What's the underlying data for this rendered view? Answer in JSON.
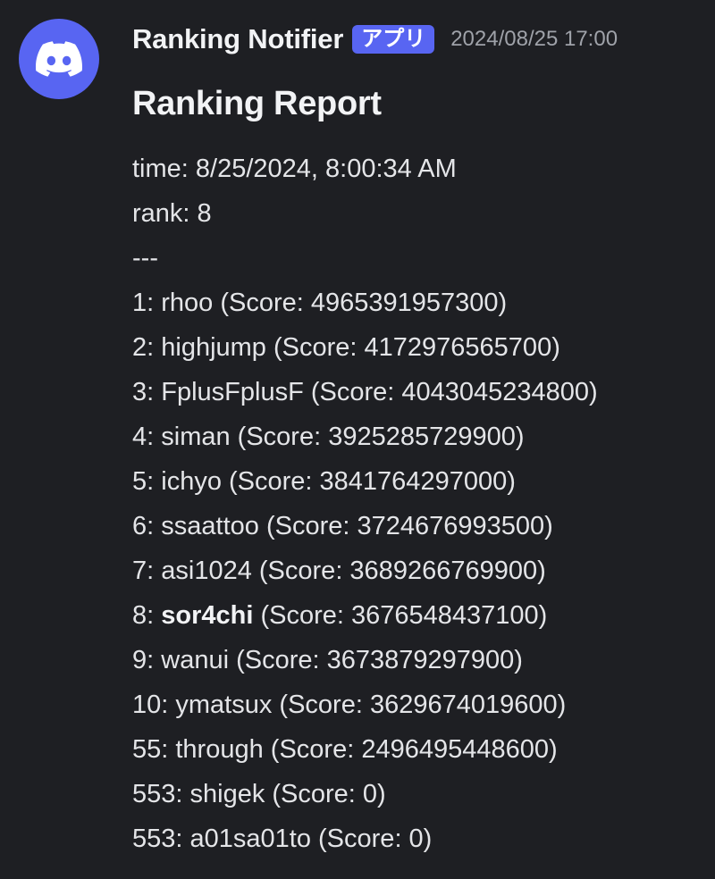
{
  "author": {
    "name": "Ranking Notifier",
    "badge": "アプリ",
    "timestamp": "2024/08/25 17:00"
  },
  "report": {
    "title": "Ranking Report",
    "time_line": "time: 8/25/2024, 8:00:34 AM",
    "rank_line": "rank: 8",
    "separator": "---",
    "entries": [
      {
        "prefix": "1: ",
        "name": "rhoo",
        "suffix": " (Score: 4965391957300)",
        "bold": false
      },
      {
        "prefix": "2: ",
        "name": "highjump",
        "suffix": " (Score: 4172976565700)",
        "bold": false
      },
      {
        "prefix": "3: ",
        "name": "FplusFplusF",
        "suffix": " (Score: 4043045234800)",
        "bold": false
      },
      {
        "prefix": "4: ",
        "name": "siman",
        "suffix": " (Score: 3925285729900)",
        "bold": false
      },
      {
        "prefix": "5: ",
        "name": "ichyo",
        "suffix": " (Score: 3841764297000)",
        "bold": false
      },
      {
        "prefix": "6: ",
        "name": "ssaattoo",
        "suffix": " (Score: 3724676993500)",
        "bold": false
      },
      {
        "prefix": "7: ",
        "name": "asi1024",
        "suffix": " (Score: 3689266769900)",
        "bold": false
      },
      {
        "prefix": "8: ",
        "name": "sor4chi",
        "suffix": " (Score: 3676548437100)",
        "bold": true
      },
      {
        "prefix": "9: ",
        "name": "wanui",
        "suffix": " (Score: 3673879297900)",
        "bold": false
      },
      {
        "prefix": "10: ",
        "name": "ymatsux",
        "suffix": " (Score: 3629674019600)",
        "bold": false
      },
      {
        "prefix": "55: ",
        "name": "through",
        "suffix": " (Score: 2496495448600)",
        "bold": false
      },
      {
        "prefix": "553: ",
        "name": "shigek",
        "suffix": " (Score: 0)",
        "bold": false
      },
      {
        "prefix": "553: ",
        "name": "a01sa01to",
        "suffix": " (Score: 0)",
        "bold": false
      }
    ]
  },
  "colors": {
    "background": "#1e1f23",
    "brand": "#5865f2",
    "timestamp": "#9fa2a9"
  },
  "icons": {
    "avatar": "discord-logo-icon"
  }
}
